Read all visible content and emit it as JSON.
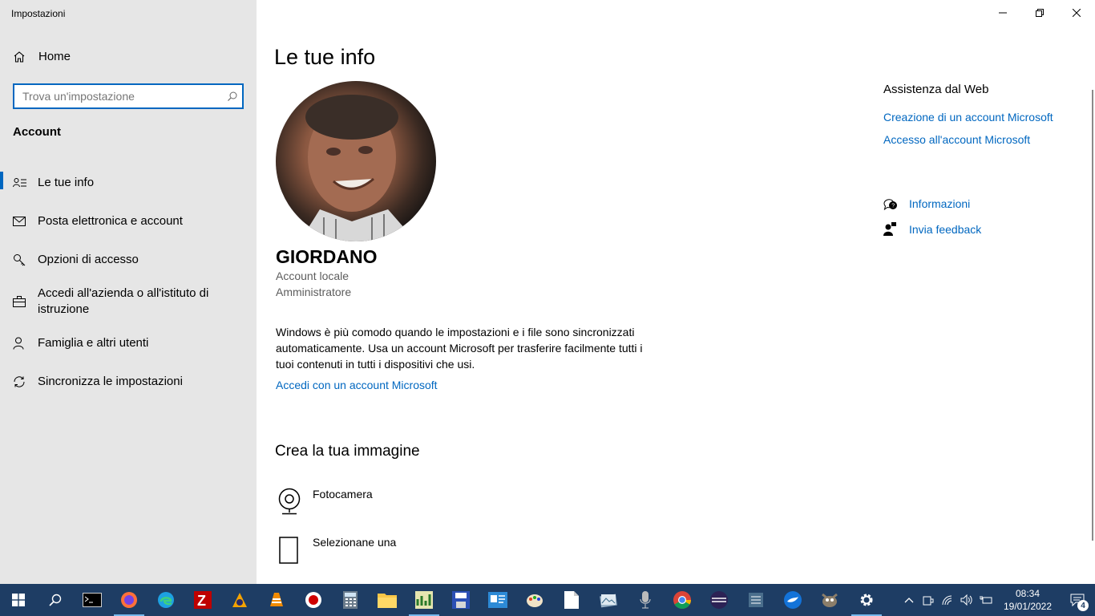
{
  "app": {
    "title": "Impostazioni"
  },
  "sidebar": {
    "home_label": "Home",
    "search_placeholder": "Trova un'impostazione",
    "section_title": "Account",
    "items": [
      {
        "label": "Le tue info",
        "icon": "person-info-icon",
        "active": true
      },
      {
        "label": "Posta elettronica e account",
        "icon": "mail-icon"
      },
      {
        "label": "Opzioni di accesso",
        "icon": "key-icon"
      },
      {
        "label": "Accedi all'azienda o all'istituto di istruzione",
        "icon": "briefcase-icon"
      },
      {
        "label": "Famiglia e altri utenti",
        "icon": "person-add-icon"
      },
      {
        "label": "Sincronizza le impostazioni",
        "icon": "sync-icon"
      }
    ]
  },
  "main": {
    "title": "Le tue info",
    "user": {
      "name": "GIORDANO",
      "account_type": "Account locale",
      "role": "Amministratore"
    },
    "description": "Windows è più comodo quando le impostazioni e i file sono sincronizzati automaticamente. Usa un account Microsoft per trasferire facilmente tutti i tuoi contenuti in tutti i dispositivi che usi.",
    "signin_link": "Accedi con un account Microsoft",
    "create_picture": {
      "title": "Crea la tua immagine",
      "camera": "Fotocamera",
      "browse": "Selezionane una"
    }
  },
  "help": {
    "heading": "Assistenza dal Web",
    "links": [
      "Creazione di un account Microsoft",
      "Accesso all'account Microsoft"
    ],
    "info": "Informazioni",
    "feedback": "Invia feedback"
  },
  "taskbar": {
    "time": "08:34",
    "date": "19/01/2022",
    "notification_count": "4",
    "accent": "#1e3d64",
    "link_color": "#0067c0"
  }
}
